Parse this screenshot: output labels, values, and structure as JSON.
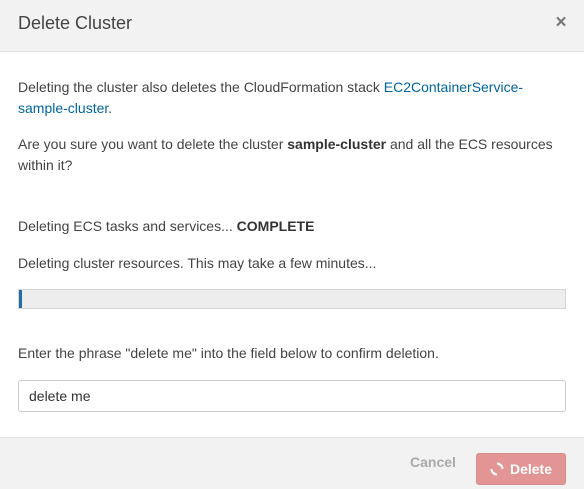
{
  "dialog": {
    "title": "Delete Cluster",
    "close_glyph": "×"
  },
  "intro": {
    "text_before_link": "Deleting the cluster also deletes the CloudFormation stack ",
    "stack_link": "EC2ContainerService-sample-cluster",
    "text_after_link": "."
  },
  "question": {
    "text_before": "Are you sure you want to delete the cluster ",
    "cluster_name": "sample-cluster",
    "text_after": " and all the ECS resources within it?"
  },
  "status": {
    "tasks_text": "Deleting ECS tasks and services... ",
    "tasks_state": "COMPLETE",
    "resources_text": "Deleting cluster resources. This may take a few minutes..."
  },
  "progress": {
    "percent": 0.5,
    "color": "#1f6fa8"
  },
  "confirm": {
    "instruction": "Enter the phrase \"delete me\" into the field below to confirm deletion.",
    "input_value": "delete me"
  },
  "footer": {
    "cancel_label": "Cancel",
    "delete_label": "Delete",
    "delete_icon": "refresh-spinner-icon",
    "delete_color": "#e39595"
  }
}
